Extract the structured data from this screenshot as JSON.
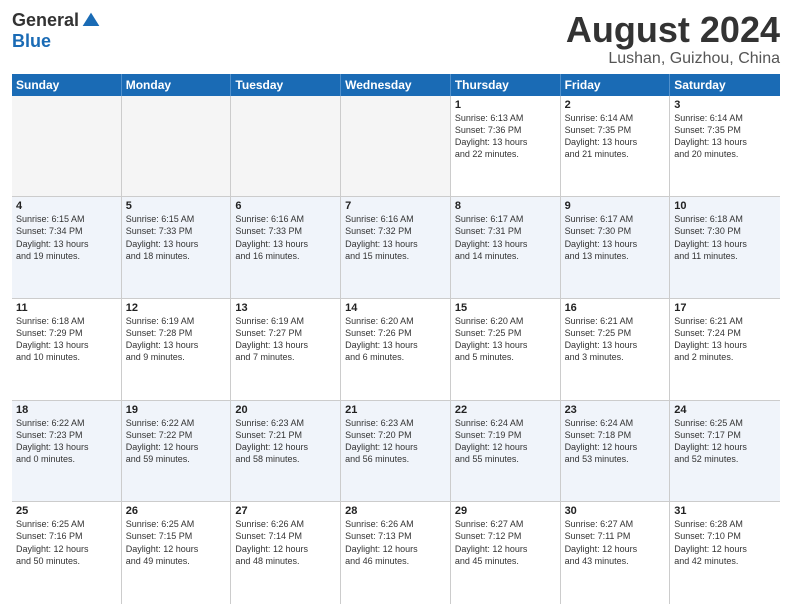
{
  "header": {
    "logo": {
      "general": "General",
      "blue": "Blue"
    },
    "title": "August 2024",
    "location": "Lushan, Guizhou, China"
  },
  "days_of_week": [
    "Sunday",
    "Monday",
    "Tuesday",
    "Wednesday",
    "Thursday",
    "Friday",
    "Saturday"
  ],
  "weeks": [
    [
      {
        "day": "",
        "info": "",
        "empty": true
      },
      {
        "day": "",
        "info": "",
        "empty": true
      },
      {
        "day": "",
        "info": "",
        "empty": true
      },
      {
        "day": "",
        "info": "",
        "empty": true
      },
      {
        "day": "1",
        "info": "Sunrise: 6:13 AM\nSunset: 7:36 PM\nDaylight: 13 hours\nand 22 minutes."
      },
      {
        "day": "2",
        "info": "Sunrise: 6:14 AM\nSunset: 7:35 PM\nDaylight: 13 hours\nand 21 minutes."
      },
      {
        "day": "3",
        "info": "Sunrise: 6:14 AM\nSunset: 7:35 PM\nDaylight: 13 hours\nand 20 minutes."
      }
    ],
    [
      {
        "day": "4",
        "info": "Sunrise: 6:15 AM\nSunset: 7:34 PM\nDaylight: 13 hours\nand 19 minutes."
      },
      {
        "day": "5",
        "info": "Sunrise: 6:15 AM\nSunset: 7:33 PM\nDaylight: 13 hours\nand 18 minutes."
      },
      {
        "day": "6",
        "info": "Sunrise: 6:16 AM\nSunset: 7:33 PM\nDaylight: 13 hours\nand 16 minutes."
      },
      {
        "day": "7",
        "info": "Sunrise: 6:16 AM\nSunset: 7:32 PM\nDaylight: 13 hours\nand 15 minutes."
      },
      {
        "day": "8",
        "info": "Sunrise: 6:17 AM\nSunset: 7:31 PM\nDaylight: 13 hours\nand 14 minutes."
      },
      {
        "day": "9",
        "info": "Sunrise: 6:17 AM\nSunset: 7:30 PM\nDaylight: 13 hours\nand 13 minutes."
      },
      {
        "day": "10",
        "info": "Sunrise: 6:18 AM\nSunset: 7:30 PM\nDaylight: 13 hours\nand 11 minutes."
      }
    ],
    [
      {
        "day": "11",
        "info": "Sunrise: 6:18 AM\nSunset: 7:29 PM\nDaylight: 13 hours\nand 10 minutes."
      },
      {
        "day": "12",
        "info": "Sunrise: 6:19 AM\nSunset: 7:28 PM\nDaylight: 13 hours\nand 9 minutes."
      },
      {
        "day": "13",
        "info": "Sunrise: 6:19 AM\nSunset: 7:27 PM\nDaylight: 13 hours\nand 7 minutes."
      },
      {
        "day": "14",
        "info": "Sunrise: 6:20 AM\nSunset: 7:26 PM\nDaylight: 13 hours\nand 6 minutes."
      },
      {
        "day": "15",
        "info": "Sunrise: 6:20 AM\nSunset: 7:25 PM\nDaylight: 13 hours\nand 5 minutes."
      },
      {
        "day": "16",
        "info": "Sunrise: 6:21 AM\nSunset: 7:25 PM\nDaylight: 13 hours\nand 3 minutes."
      },
      {
        "day": "17",
        "info": "Sunrise: 6:21 AM\nSunset: 7:24 PM\nDaylight: 13 hours\nand 2 minutes."
      }
    ],
    [
      {
        "day": "18",
        "info": "Sunrise: 6:22 AM\nSunset: 7:23 PM\nDaylight: 13 hours\nand 0 minutes."
      },
      {
        "day": "19",
        "info": "Sunrise: 6:22 AM\nSunset: 7:22 PM\nDaylight: 12 hours\nand 59 minutes."
      },
      {
        "day": "20",
        "info": "Sunrise: 6:23 AM\nSunset: 7:21 PM\nDaylight: 12 hours\nand 58 minutes."
      },
      {
        "day": "21",
        "info": "Sunrise: 6:23 AM\nSunset: 7:20 PM\nDaylight: 12 hours\nand 56 minutes."
      },
      {
        "day": "22",
        "info": "Sunrise: 6:24 AM\nSunset: 7:19 PM\nDaylight: 12 hours\nand 55 minutes."
      },
      {
        "day": "23",
        "info": "Sunrise: 6:24 AM\nSunset: 7:18 PM\nDaylight: 12 hours\nand 53 minutes."
      },
      {
        "day": "24",
        "info": "Sunrise: 6:25 AM\nSunset: 7:17 PM\nDaylight: 12 hours\nand 52 minutes."
      }
    ],
    [
      {
        "day": "25",
        "info": "Sunrise: 6:25 AM\nSunset: 7:16 PM\nDaylight: 12 hours\nand 50 minutes."
      },
      {
        "day": "26",
        "info": "Sunrise: 6:25 AM\nSunset: 7:15 PM\nDaylight: 12 hours\nand 49 minutes."
      },
      {
        "day": "27",
        "info": "Sunrise: 6:26 AM\nSunset: 7:14 PM\nDaylight: 12 hours\nand 48 minutes."
      },
      {
        "day": "28",
        "info": "Sunrise: 6:26 AM\nSunset: 7:13 PM\nDaylight: 12 hours\nand 46 minutes."
      },
      {
        "day": "29",
        "info": "Sunrise: 6:27 AM\nSunset: 7:12 PM\nDaylight: 12 hours\nand 45 minutes."
      },
      {
        "day": "30",
        "info": "Sunrise: 6:27 AM\nSunset: 7:11 PM\nDaylight: 12 hours\nand 43 minutes."
      },
      {
        "day": "31",
        "info": "Sunrise: 6:28 AM\nSunset: 7:10 PM\nDaylight: 12 hours\nand 42 minutes."
      }
    ]
  ],
  "alt_rows": [
    1,
    3
  ]
}
